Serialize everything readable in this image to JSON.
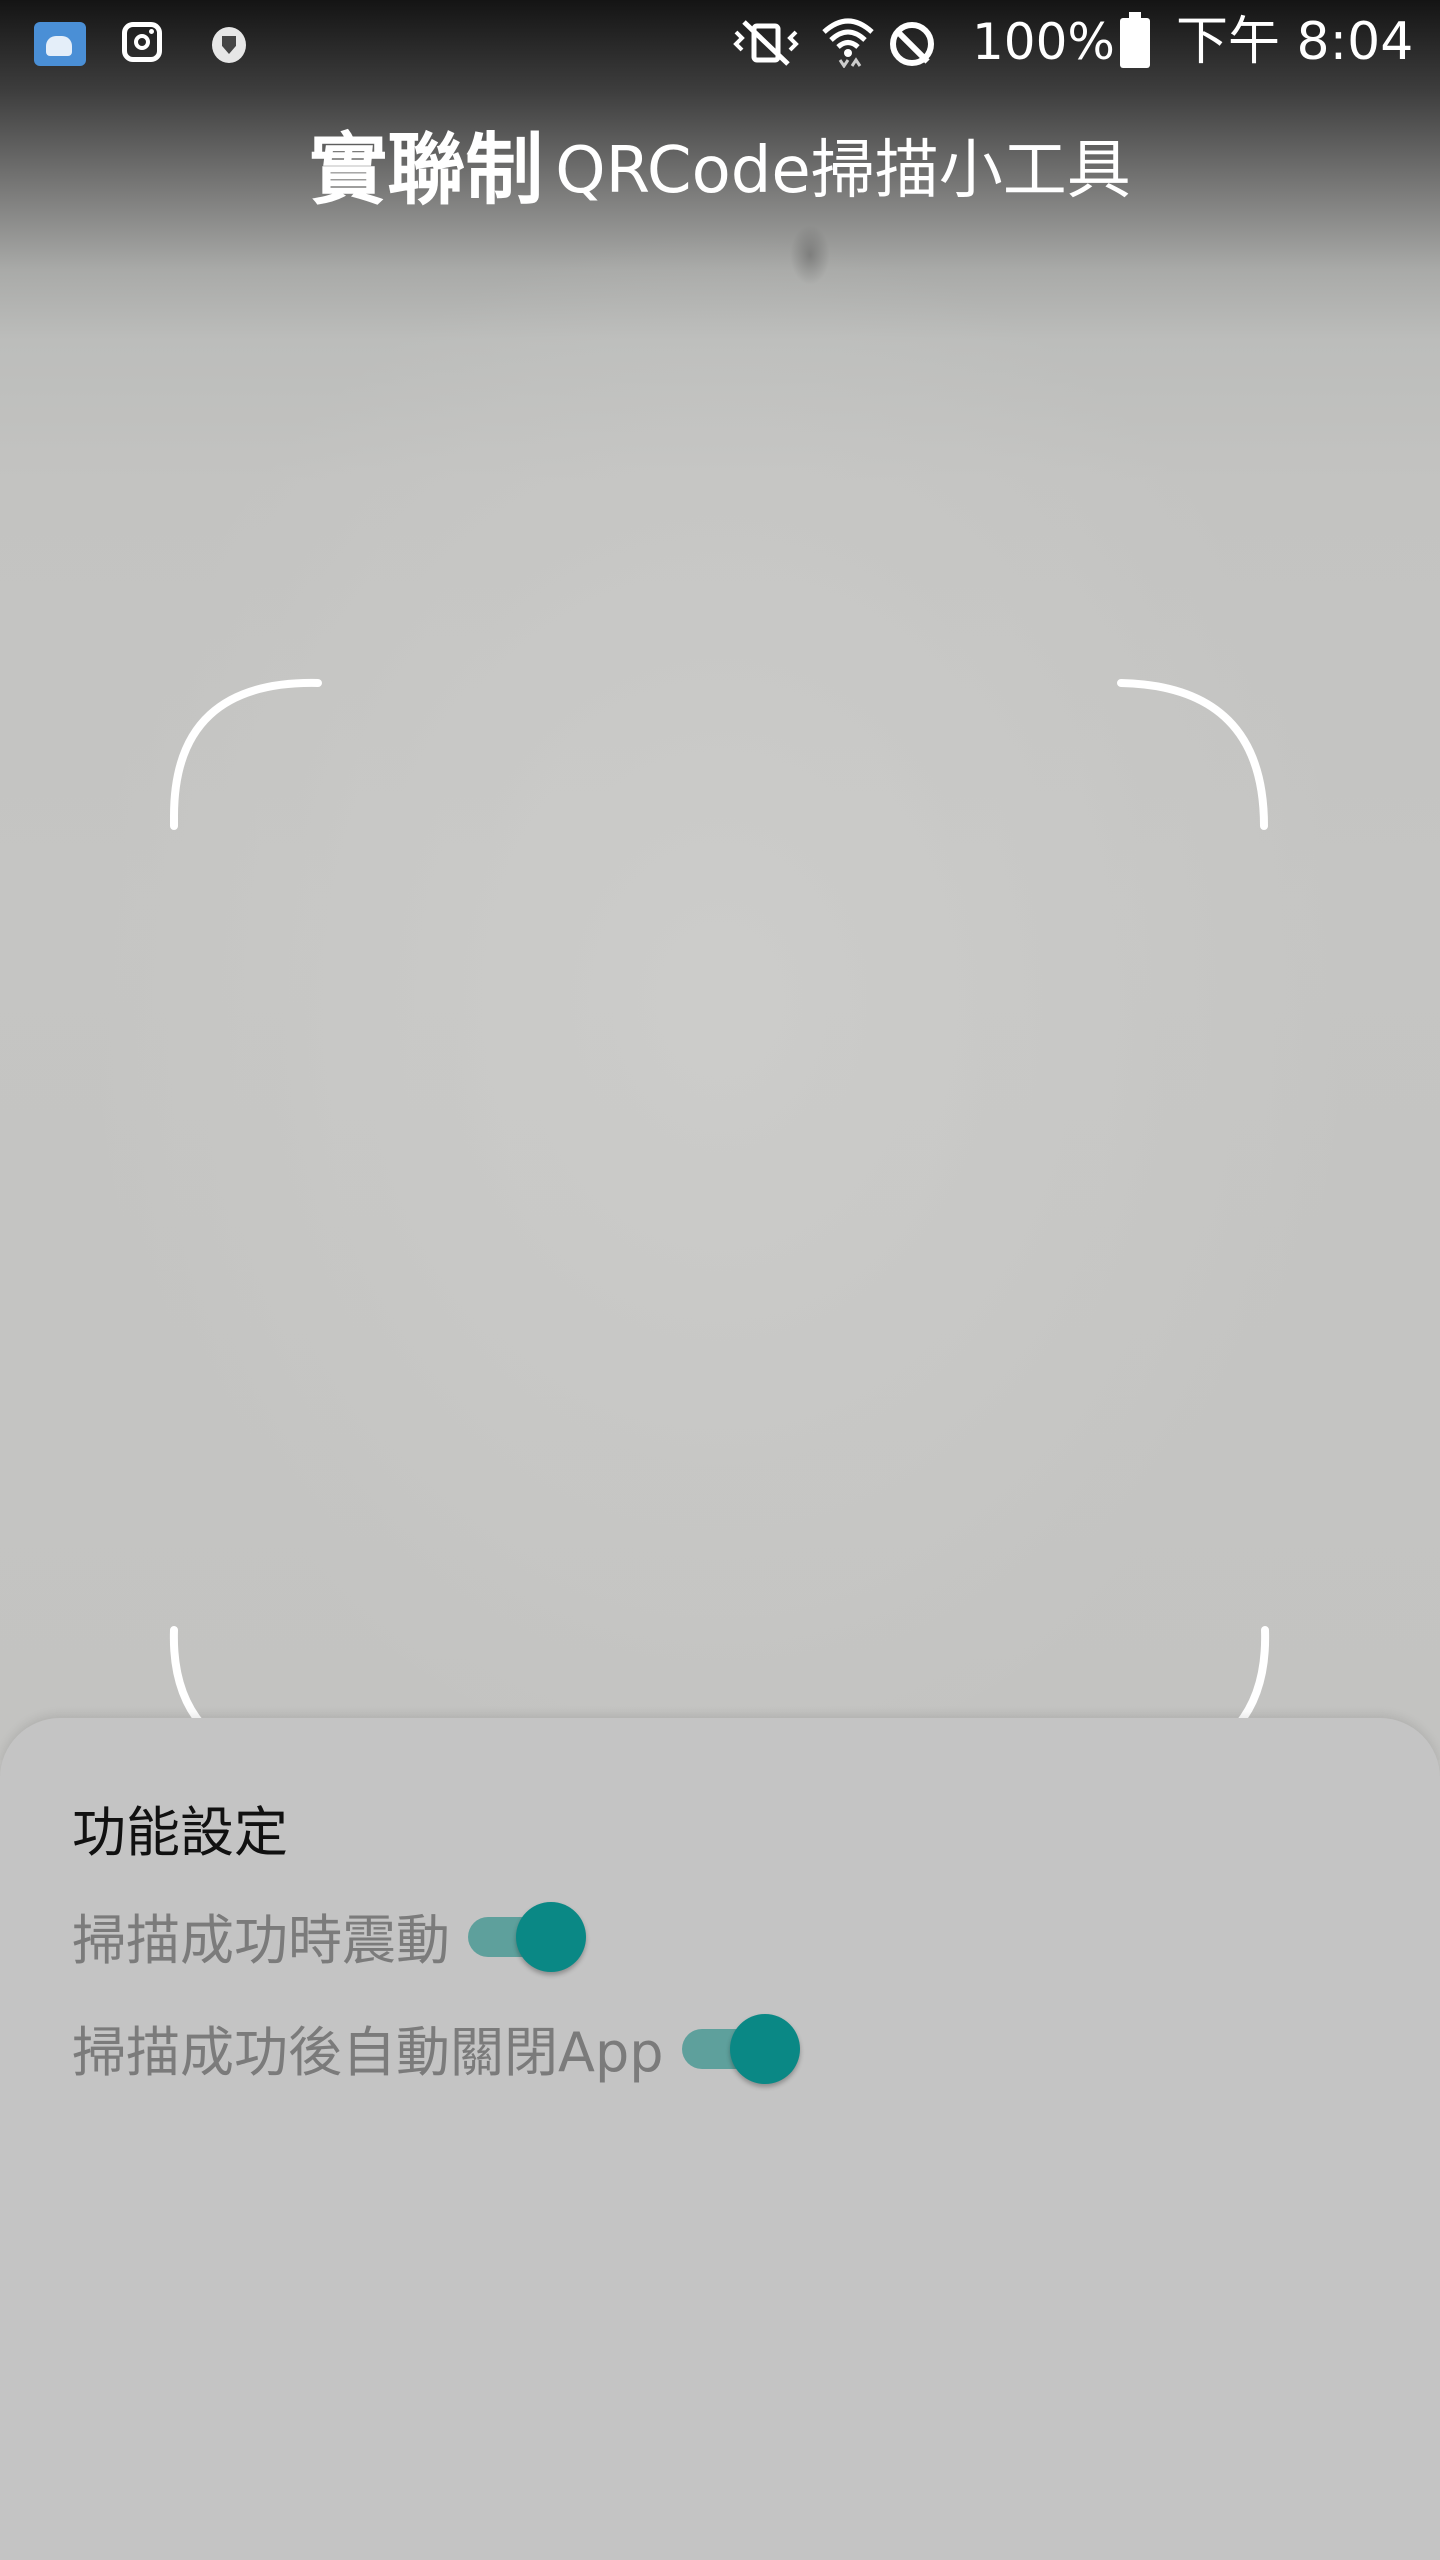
{
  "status_bar": {
    "icons": [
      "es-file-explorer-icon",
      "instagram-icon",
      "vpn-shield-icon",
      "vibrate-mute-icon",
      "wifi-icon",
      "do-not-disturb-icon",
      "battery-icon"
    ],
    "battery_percent": "100%",
    "time": "下午 8:04"
  },
  "header": {
    "title_bold": "實聯制",
    "title_rest": "QRCode掃描小工具"
  },
  "scanner": {
    "frame_color": "#ffffff"
  },
  "settings_sheet": {
    "title": "功能設定",
    "items": [
      {
        "label": "掃描成功時震動",
        "enabled": true
      },
      {
        "label": "掃描成功後自動關閉App",
        "enabled": true
      }
    ],
    "accent_color": "#0a8885"
  }
}
